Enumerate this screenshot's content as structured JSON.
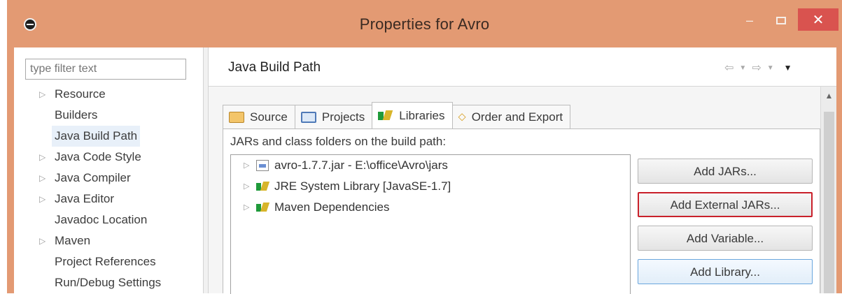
{
  "window": {
    "title": "Properties for Avro",
    "controls": {
      "minimize": "–",
      "close": "✕"
    }
  },
  "nav": {
    "filter_placeholder": "type filter text",
    "items": [
      {
        "label": "Resource",
        "expandable": true
      },
      {
        "label": "Builders",
        "expandable": false
      },
      {
        "label": "Java Build Path",
        "expandable": false,
        "selected": true
      },
      {
        "label": "Java Code Style",
        "expandable": true
      },
      {
        "label": "Java Compiler",
        "expandable": true
      },
      {
        "label": "Java Editor",
        "expandable": true
      },
      {
        "label": "Javadoc Location",
        "expandable": false
      },
      {
        "label": "Maven",
        "expandable": true
      },
      {
        "label": "Project References",
        "expandable": false
      },
      {
        "label": "Run/Debug Settings",
        "expandable": false
      }
    ]
  },
  "main": {
    "page_title": "Java Build Path",
    "tabs": [
      {
        "label": "Source",
        "icon": "source-folder-icon"
      },
      {
        "label": "Projects",
        "icon": "projects-folder-icon"
      },
      {
        "label": "Libraries",
        "icon": "libraries-icon",
        "active": true
      },
      {
        "label": "Order and Export",
        "icon": "order-export-icon"
      }
    ],
    "panel_label": "JARs and class folders on the build path:",
    "tree": [
      {
        "label": "avro-1.7.7.jar - E:\\office\\Avro\\jars",
        "icon": "jar-icon"
      },
      {
        "label": "JRE System Library [JavaSE-1.7]",
        "icon": "library-icon"
      },
      {
        "label": "Maven Dependencies",
        "icon": "library-icon"
      }
    ],
    "buttons": {
      "add_jars": "Add JARs...",
      "add_external_jars": "Add External JARs...",
      "add_variable": "Add Variable...",
      "add_library": "Add Library..."
    }
  },
  "colors": {
    "titlebar": "#e39a73",
    "close_button": "#d9534f",
    "highlight_border": "#c9202a"
  }
}
